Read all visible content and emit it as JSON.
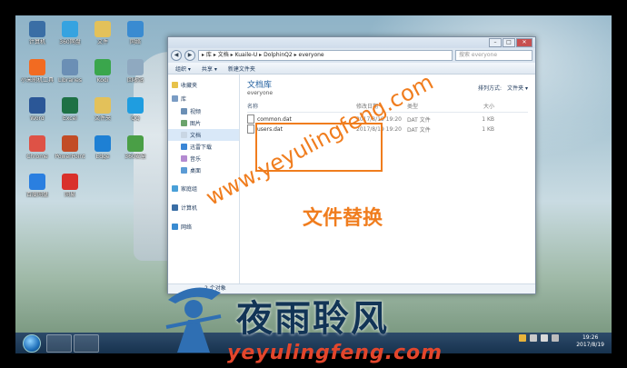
{
  "desktop": {
    "icons": [
      {
        "label": "计算机",
        "color": "#3a6ea5"
      },
      {
        "label": "360网盘",
        "color": "#36a3e0"
      },
      {
        "label": "文件",
        "color": "#e3c15a"
      },
      {
        "label": "网络",
        "color": "#3a8bd1"
      },
      {
        "label": "小米刷机工具",
        "color": "#f26b21"
      },
      {
        "label": "Libraries",
        "color": "#6b8fb5"
      },
      {
        "label": "Kodi",
        "color": "#3aa64c"
      },
      {
        "label": "回收站",
        "color": "#8fa9c0"
      },
      {
        "label": "Word",
        "color": "#2b5797"
      },
      {
        "label": "Excel",
        "color": "#1e7145"
      },
      {
        "label": "文件夹",
        "color": "#e3c15a"
      },
      {
        "label": "QQ",
        "color": "#1f9de0"
      },
      {
        "label": "Chrome",
        "color": "#de5246"
      },
      {
        "label": "PowerPoint",
        "color": "#c24c26"
      },
      {
        "label": "Edge",
        "color": "#1e80d4"
      },
      {
        "label": "360安全",
        "color": "#4a9f46"
      },
      {
        "label": "百度网盘",
        "color": "#2a7fe0"
      },
      {
        "label": "网易",
        "color": "#d9312b"
      }
    ]
  },
  "window": {
    "nav_back": "◀",
    "nav_fwd": "▶",
    "address": "▸ 库 ▸ 文档 ▸ Kuaile-U ▸ DolphinQ2 ▸ everyone",
    "search_placeholder": "搜索 everyone",
    "toolbar": {
      "organize": "组织 ▾",
      "share": "共享 ▾",
      "new_folder": "新建文件夹"
    },
    "nav": {
      "favorites": "收藏夹",
      "libraries": "库",
      "lib_items": [
        "视频",
        "图片",
        "文档",
        "迅雷下载",
        "音乐",
        "桌面"
      ],
      "homegroup": "家庭组",
      "computer": "计算机",
      "network": "网络"
    },
    "library_title": "文档库",
    "library_subtitle": "everyone",
    "arrange_label": "排列方式:",
    "arrange_value": "文件夹 ▾",
    "columns": {
      "name": "名称",
      "date": "修改日期",
      "type": "类型",
      "size": "大小"
    },
    "files": [
      {
        "name": "common.dat",
        "date": "2017/8/19 19:20",
        "type": "DAT 文件",
        "size": "1 KB"
      },
      {
        "name": "users.dat",
        "date": "2017/8/19 19:20",
        "type": "DAT 文件",
        "size": "1 KB"
      }
    ],
    "status": "2 个对象"
  },
  "overlay": {
    "watermark_url": "www.yeyulingfeng.com",
    "caption": "文件替换",
    "brand_cn": "夜雨聆风",
    "brand_en": "yeyulingfeng.com"
  },
  "taskbar": {
    "time": "19:26",
    "date": "2017/8/19"
  }
}
